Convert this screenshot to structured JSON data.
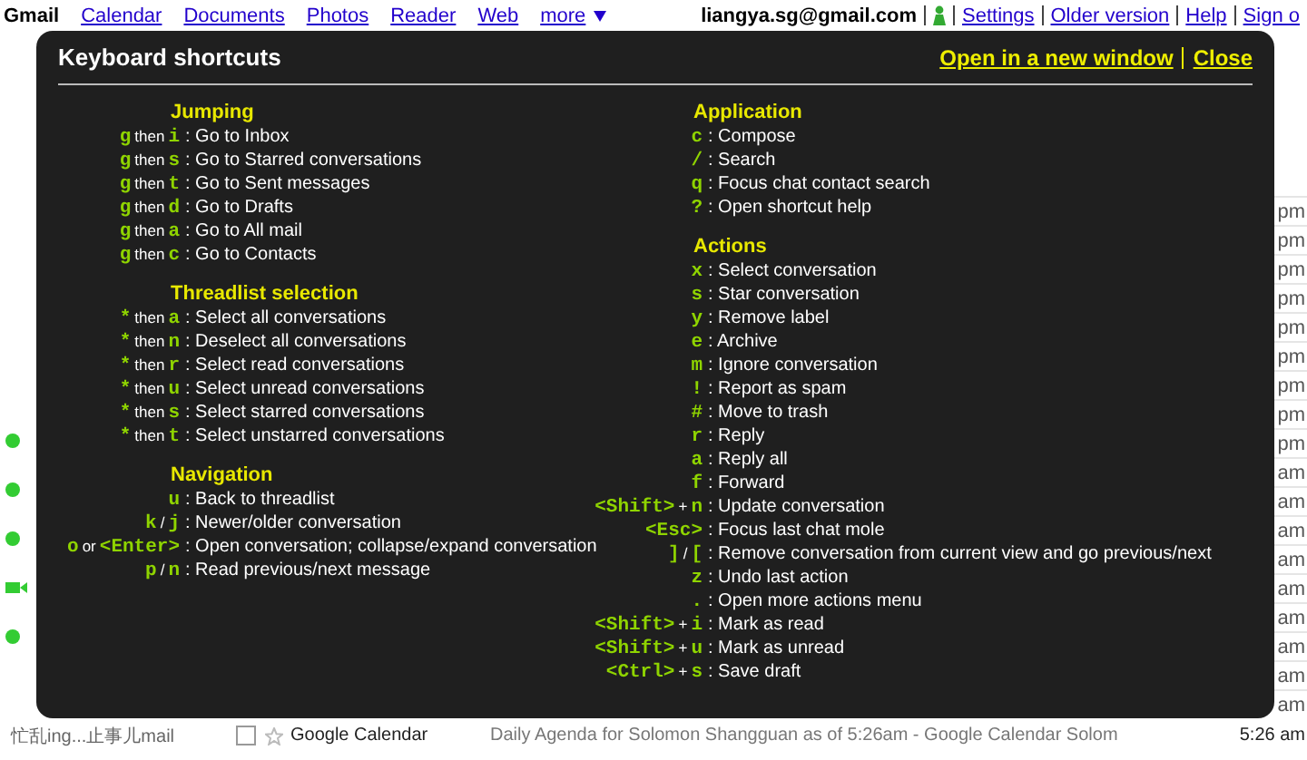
{
  "top_bar": {
    "brand": "Gmail",
    "links": [
      "Calendar",
      "Documents",
      "Photos",
      "Reader",
      "Web"
    ],
    "more": "more",
    "account": "liangya.sg@gmail.com",
    "account_links": [
      "Settings",
      "Older version",
      "Help",
      "Sign o"
    ]
  },
  "sidebar": {
    "contacts": [
      {
        "kind": "dot"
      },
      {
        "kind": "dot"
      },
      {
        "kind": "dot"
      },
      {
        "kind": "video"
      },
      {
        "kind": "dot"
      }
    ],
    "status_text": "忙乱ing...止事儿mail"
  },
  "message_list": {
    "rows": [
      {
        "time": "pm"
      },
      {
        "time": "pm"
      },
      {
        "time": "pm"
      },
      {
        "time": "pm"
      },
      {
        "time": "pm"
      },
      {
        "time": "pm"
      },
      {
        "time": "pm"
      },
      {
        "time": "pm"
      },
      {
        "time": "pm"
      },
      {
        "time": "am"
      },
      {
        "time": "am"
      },
      {
        "time": "am"
      },
      {
        "time": "am"
      },
      {
        "time": "am"
      },
      {
        "time": "am"
      },
      {
        "time": "am"
      },
      {
        "time": "am"
      },
      {
        "time": "am"
      }
    ],
    "bottom_row": {
      "checked": false,
      "sender": "Google Calendar",
      "subject": "Daily Agenda for Solomon Shangguan as of 5:26am - Google Calendar Solom",
      "time": "5:26 am"
    }
  },
  "shortcuts_overlay": {
    "title": "Keyboard shortcuts",
    "links": [
      "Open in a new window",
      "Close"
    ],
    "columns": [
      {
        "sections": [
          {
            "title": "Jumping",
            "shortcuts": [
              {
                "keys": [
                  {
                    "t": "g",
                    "kind": "key"
                  },
                  {
                    "t": "then",
                    "kind": "word"
                  },
                  {
                    "t": "i",
                    "kind": "key"
                  }
                ],
                "action": ": Go to Inbox"
              },
              {
                "keys": [
                  {
                    "t": "g",
                    "kind": "key"
                  },
                  {
                    "t": "then",
                    "kind": "word"
                  },
                  {
                    "t": "s",
                    "kind": "key"
                  }
                ],
                "action": ": Go to Starred conversations"
              },
              {
                "keys": [
                  {
                    "t": "g",
                    "kind": "key"
                  },
                  {
                    "t": "then",
                    "kind": "word"
                  },
                  {
                    "t": "t",
                    "kind": "key"
                  }
                ],
                "action": ": Go to Sent messages"
              },
              {
                "keys": [
                  {
                    "t": "g",
                    "kind": "key"
                  },
                  {
                    "t": "then",
                    "kind": "word"
                  },
                  {
                    "t": "d",
                    "kind": "key"
                  }
                ],
                "action": ": Go to Drafts"
              },
              {
                "keys": [
                  {
                    "t": "g",
                    "kind": "key"
                  },
                  {
                    "t": "then",
                    "kind": "word"
                  },
                  {
                    "t": "a",
                    "kind": "key"
                  }
                ],
                "action": ": Go to All mail"
              },
              {
                "keys": [
                  {
                    "t": "g",
                    "kind": "key"
                  },
                  {
                    "t": "then",
                    "kind": "word"
                  },
                  {
                    "t": "c",
                    "kind": "key"
                  }
                ],
                "action": ": Go to Contacts"
              }
            ]
          },
          {
            "title": "Threadlist selection",
            "shortcuts": [
              {
                "keys": [
                  {
                    "t": "*",
                    "kind": "key"
                  },
                  {
                    "t": "then",
                    "kind": "word"
                  },
                  {
                    "t": "a",
                    "kind": "key"
                  }
                ],
                "action": ": Select all conversations"
              },
              {
                "keys": [
                  {
                    "t": "*",
                    "kind": "key"
                  },
                  {
                    "t": "then",
                    "kind": "word"
                  },
                  {
                    "t": "n",
                    "kind": "key"
                  }
                ],
                "action": ": Deselect all conversations"
              },
              {
                "keys": [
                  {
                    "t": "*",
                    "kind": "key"
                  },
                  {
                    "t": "then",
                    "kind": "word"
                  },
                  {
                    "t": "r",
                    "kind": "key"
                  }
                ],
                "action": ": Select read conversations"
              },
              {
                "keys": [
                  {
                    "t": "*",
                    "kind": "key"
                  },
                  {
                    "t": "then",
                    "kind": "word"
                  },
                  {
                    "t": "u",
                    "kind": "key"
                  }
                ],
                "action": ": Select unread conversations"
              },
              {
                "keys": [
                  {
                    "t": "*",
                    "kind": "key"
                  },
                  {
                    "t": "then",
                    "kind": "word"
                  },
                  {
                    "t": "s",
                    "kind": "key"
                  }
                ],
                "action": ": Select starred conversations"
              },
              {
                "keys": [
                  {
                    "t": "*",
                    "kind": "key"
                  },
                  {
                    "t": "then",
                    "kind": "word"
                  },
                  {
                    "t": "t",
                    "kind": "key"
                  }
                ],
                "action": ": Select unstarred conversations"
              }
            ]
          },
          {
            "title": "Navigation",
            "shortcuts": [
              {
                "keys": [
                  {
                    "t": "u",
                    "kind": "key"
                  }
                ],
                "action": ": Back to threadlist"
              },
              {
                "keys": [
                  {
                    "t": "k",
                    "kind": "key"
                  },
                  {
                    "t": "/",
                    "kind": "word"
                  },
                  {
                    "t": "j",
                    "kind": "key"
                  }
                ],
                "action": ": Newer/older conversation"
              },
              {
                "keys": [
                  {
                    "t": "o",
                    "kind": "key"
                  },
                  {
                    "t": "or",
                    "kind": "word"
                  },
                  {
                    "t": "<Enter>",
                    "kind": "key"
                  }
                ],
                "action": ": Open conversation; collapse/expand conversation"
              },
              {
                "keys": [
                  {
                    "t": "p",
                    "kind": "key"
                  },
                  {
                    "t": "/",
                    "kind": "word"
                  },
                  {
                    "t": "n",
                    "kind": "key"
                  }
                ],
                "action": ": Read previous/next message"
              }
            ]
          }
        ]
      },
      {
        "sections": [
          {
            "title": "Application",
            "shortcuts": [
              {
                "keys": [
                  {
                    "t": "c",
                    "kind": "key"
                  }
                ],
                "action": ": Compose"
              },
              {
                "keys": [
                  {
                    "t": "/",
                    "kind": "key"
                  }
                ],
                "action": ": Search"
              },
              {
                "keys": [
                  {
                    "t": "q",
                    "kind": "key"
                  }
                ],
                "action": ": Focus chat contact search"
              },
              {
                "keys": [
                  {
                    "t": "?",
                    "kind": "key"
                  }
                ],
                "action": ": Open shortcut help"
              }
            ]
          },
          {
            "title": "Actions",
            "shortcuts": [
              {
                "keys": [
                  {
                    "t": "x",
                    "kind": "key"
                  }
                ],
                "action": ": Select conversation"
              },
              {
                "keys": [
                  {
                    "t": "s",
                    "kind": "key"
                  }
                ],
                "action": ": Star conversation"
              },
              {
                "keys": [
                  {
                    "t": "y",
                    "kind": "key"
                  }
                ],
                "action": ": Remove label"
              },
              {
                "keys": [
                  {
                    "t": "e",
                    "kind": "key"
                  }
                ],
                "action": ": Archive"
              },
              {
                "keys": [
                  {
                    "t": "m",
                    "kind": "key"
                  }
                ],
                "action": ": Ignore conversation"
              },
              {
                "keys": [
                  {
                    "t": "!",
                    "kind": "key"
                  }
                ],
                "action": ": Report as spam"
              },
              {
                "keys": [
                  {
                    "t": "#",
                    "kind": "key"
                  }
                ],
                "action": ": Move to trash"
              },
              {
                "keys": [
                  {
                    "t": "r",
                    "kind": "key"
                  }
                ],
                "action": ": Reply"
              },
              {
                "keys": [
                  {
                    "t": "a",
                    "kind": "key"
                  }
                ],
                "action": ": Reply all"
              },
              {
                "keys": [
                  {
                    "t": "f",
                    "kind": "key"
                  }
                ],
                "action": ": Forward"
              },
              {
                "keys": [
                  {
                    "t": "<Shift>",
                    "kind": "key"
                  },
                  {
                    "t": "+",
                    "kind": "word"
                  },
                  {
                    "t": "n",
                    "kind": "key"
                  }
                ],
                "action": ": Update conversation"
              },
              {
                "keys": [
                  {
                    "t": "<Esc>",
                    "kind": "key"
                  }
                ],
                "action": ": Focus last chat mole"
              },
              {
                "keys": [
                  {
                    "t": "]",
                    "kind": "key"
                  },
                  {
                    "t": "/",
                    "kind": "word"
                  },
                  {
                    "t": "[",
                    "kind": "key"
                  }
                ],
                "action": ": Remove conversation from current view and go previous/next"
              },
              {
                "keys": [
                  {
                    "t": "z",
                    "kind": "key"
                  }
                ],
                "action": ": Undo last action"
              },
              {
                "keys": [
                  {
                    "t": ".",
                    "kind": "key"
                  }
                ],
                "action": ": Open more actions menu"
              },
              {
                "keys": [
                  {
                    "t": "<Shift>",
                    "kind": "key"
                  },
                  {
                    "t": "+",
                    "kind": "word"
                  },
                  {
                    "t": "i",
                    "kind": "key"
                  }
                ],
                "action": ": Mark as read"
              },
              {
                "keys": [
                  {
                    "t": "<Shift>",
                    "kind": "key"
                  },
                  {
                    "t": "+",
                    "kind": "word"
                  },
                  {
                    "t": "u",
                    "kind": "key"
                  }
                ],
                "action": ": Mark as unread"
              },
              {
                "keys": [
                  {
                    "t": "<Ctrl>",
                    "kind": "key"
                  },
                  {
                    "t": "+",
                    "kind": "word"
                  },
                  {
                    "t": "s",
                    "kind": "key"
                  }
                ],
                "action": ": Save draft"
              }
            ]
          }
        ]
      }
    ]
  }
}
